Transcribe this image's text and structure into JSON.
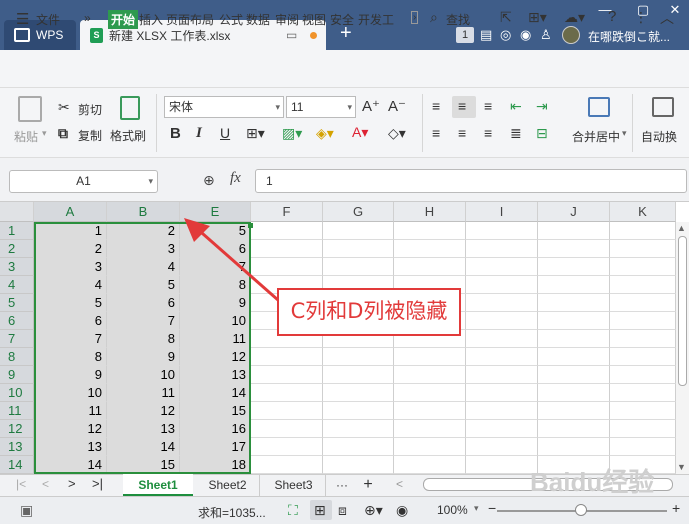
{
  "titlebar": {
    "wps_label": "WPS",
    "doc_tab_title": "新建 XLSX 工作表.xlsx",
    "tab_count": "1",
    "user_name": "在哪跌倒こ就...",
    "add_tab": "+"
  },
  "menubar": {
    "file": "文件",
    "items": [
      "开始",
      "插入",
      "页面布局",
      "公式",
      "数据",
      "审阅",
      "视图",
      "安全",
      "开发工"
    ],
    "search": "查找"
  },
  "ribbon": {
    "paste": "粘贴",
    "cut": "剪切",
    "copy": "复制",
    "format_painter": "格式刷",
    "font_name": "宋体",
    "font_size": "11",
    "bold": "B",
    "italic": "I",
    "underline": "U",
    "merge_center": "合并居中",
    "auto_wrap": "自动换"
  },
  "formula": {
    "name_box": "A1",
    "fx": "fx",
    "value": "1"
  },
  "grid": {
    "columns": [
      "A",
      "B",
      "E",
      "F",
      "G",
      "H",
      "I",
      "J",
      "K"
    ],
    "rows": [
      "1",
      "2",
      "3",
      "4",
      "5",
      "6",
      "7",
      "8",
      "9",
      "10",
      "11",
      "12",
      "13",
      "14"
    ],
    "colA": [
      "1",
      "2",
      "3",
      "4",
      "5",
      "6",
      "7",
      "8",
      "9",
      "10",
      "11",
      "12",
      "13",
      "14"
    ],
    "colB": [
      "2",
      "3",
      "4",
      "5",
      "6",
      "7",
      "8",
      "9",
      "10",
      "11",
      "12",
      "13",
      "14",
      "15"
    ],
    "colE": [
      "5",
      "6",
      "7",
      "8",
      "9",
      "10",
      "11",
      "12",
      "13",
      "14",
      "15",
      "16",
      "17",
      "18"
    ]
  },
  "callout": "C列和D列被隐藏",
  "sheets": [
    "Sheet1",
    "Sheet2",
    "Sheet3"
  ],
  "status": {
    "sum": "求和=1035...",
    "zoom": "100%"
  },
  "watermark": "Baidu经验"
}
